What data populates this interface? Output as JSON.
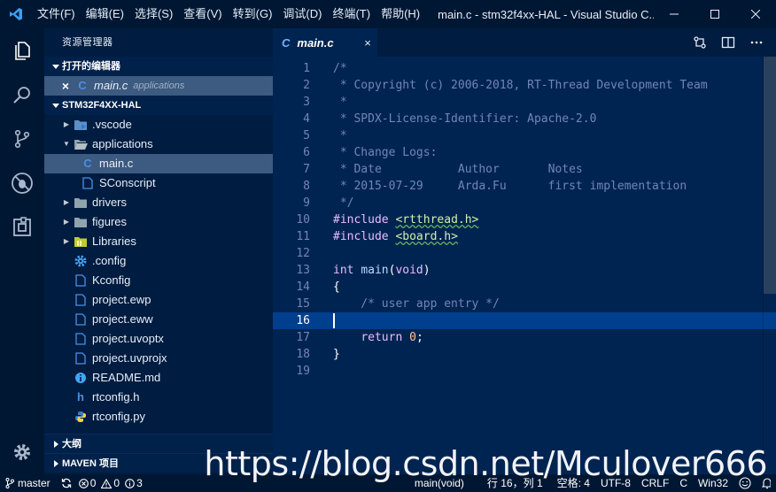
{
  "window": {
    "title": "main.c - stm32f4xx-HAL - Visual Studio C...",
    "menu": [
      "文件(F)",
      "编辑(E)",
      "选择(S)",
      "查看(V)",
      "转到(G)",
      "调试(D)",
      "终端(T)",
      "帮助(H)"
    ]
  },
  "sidebar": {
    "title": "资源管理器",
    "open_editors": {
      "label": "打开的编辑器",
      "items": [
        {
          "close": "×",
          "icon": "C",
          "name": "main.c",
          "folder": "applications"
        }
      ]
    },
    "project": {
      "label": "STM32F4XX-HAL",
      "items": [
        {
          "name": ".vscode",
          "icon": "vscode-folder-icon",
          "twistie": "▶"
        },
        {
          "name": "applications",
          "icon": "folder-open-icon",
          "twistie": "▼"
        },
        {
          "name": "main.c",
          "icon": "C"
        },
        {
          "name": "SConscript",
          "icon": "file-icon"
        },
        {
          "name": "drivers",
          "icon": "folder-icon",
          "twistie": "▶"
        },
        {
          "name": "figures",
          "icon": "folder-icon",
          "twistie": "▶"
        },
        {
          "name": "Libraries",
          "icon": "lib-folder-icon",
          "twistie": "▶"
        },
        {
          "name": ".config",
          "icon": "gear-icon"
        },
        {
          "name": "Kconfig",
          "icon": "file-icon"
        },
        {
          "name": "project.ewp",
          "icon": "file-icon"
        },
        {
          "name": "project.eww",
          "icon": "file-icon"
        },
        {
          "name": "project.uvoptx",
          "icon": "file-icon"
        },
        {
          "name": "project.uvprojx",
          "icon": "file-icon"
        },
        {
          "name": "README.md",
          "icon": "info-icon"
        },
        {
          "name": "rtconfig.h",
          "icon": "h"
        },
        {
          "name": "rtconfig.py",
          "icon": "python-icon"
        }
      ]
    },
    "outline_label": "大纲",
    "maven_label": "MAVEN 项目"
  },
  "editor": {
    "tab": {
      "icon": "C",
      "name": "main.c",
      "close": "×"
    },
    "lines": [
      {
        "n": "1",
        "t": "/*"
      },
      {
        "n": "2",
        "t": " * Copyright (c) 2006-2018, RT-Thread Development Team"
      },
      {
        "n": "3",
        "t": " *"
      },
      {
        "n": "4",
        "t": " * SPDX-License-Identifier: Apache-2.0"
      },
      {
        "n": "5",
        "t": " *"
      },
      {
        "n": "6",
        "t": " * Change Logs:"
      },
      {
        "n": "7",
        "t": " * Date           Author       Notes"
      },
      {
        "n": "8",
        "t": " * 2015-07-29     Arda.Fu      first implementation"
      },
      {
        "n": "9",
        "t": " */"
      },
      {
        "n": "10",
        "t": "#include <rtthread.h>"
      },
      {
        "n": "11",
        "t": "#include <board.h>"
      },
      {
        "n": "12",
        "t": ""
      },
      {
        "n": "13",
        "t": "int main(void)"
      },
      {
        "n": "14",
        "t": "{"
      },
      {
        "n": "15",
        "t": "    /* user app entry */"
      },
      {
        "n": "16",
        "t": ""
      },
      {
        "n": "17",
        "t": "    return 0;"
      },
      {
        "n": "18",
        "t": "}"
      },
      {
        "n": "19",
        "t": ""
      }
    ],
    "current_line": "16"
  },
  "status": {
    "branch": "master",
    "errors": "0",
    "warnings": "0",
    "infos": "3",
    "function": "main(void)",
    "position": "行 16，列 1",
    "spaces": "空格: 4",
    "encoding": "UTF-8",
    "eol": "CRLF",
    "language": "C",
    "platform": "Win32"
  },
  "watermark": "https://blog.csdn.net/Mculover666",
  "colors": {
    "background": "#002451",
    "sidebar": "#001c40",
    "chrome": "#001733",
    "selection": "#3d5a80",
    "current_line": "#003f8e"
  }
}
